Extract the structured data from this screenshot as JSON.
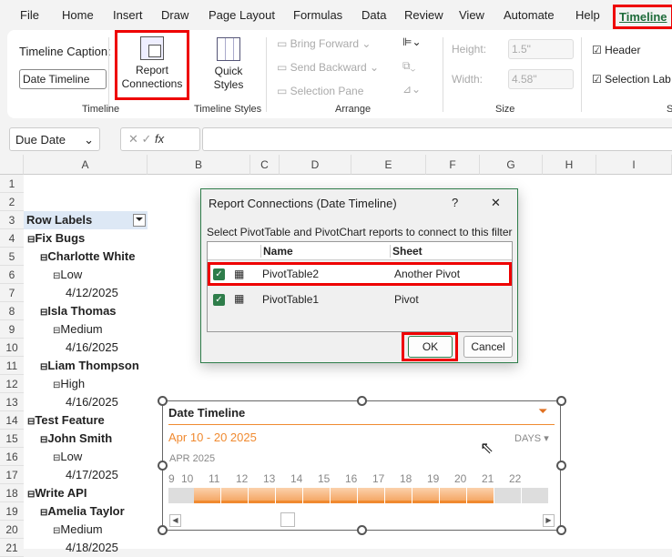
{
  "tabs": [
    "File",
    "Home",
    "Insert",
    "Draw",
    "Page Layout",
    "Formulas",
    "Data",
    "Review",
    "View",
    "Automate",
    "Help",
    "Timeline"
  ],
  "ribbon": {
    "caption_label": "Timeline Caption:",
    "caption_value": "Date Timeline",
    "report_connections": "Report Connections",
    "quick_styles": "Quick Styles",
    "bring_forward": "Bring Forward",
    "send_backward": "Send Backward",
    "selection_pane": "Selection Pane",
    "height_label": "Height:",
    "height_value": "1.5\"",
    "width_label": "Width:",
    "width_value": "4.58\"",
    "header": "Header",
    "selection_label": "Selection Lab",
    "groups": [
      "Timeline",
      "Timeline Styles",
      "Arrange",
      "Size",
      "Sh"
    ]
  },
  "formula_bar": {
    "name_box": "Due Date",
    "fx": "fx"
  },
  "columns": [
    "A",
    "B",
    "C",
    "D",
    "E",
    "F",
    "G",
    "H",
    "I"
  ],
  "rows": [
    {
      "n": "1",
      "t": "",
      "lvl": 0
    },
    {
      "n": "2",
      "t": "",
      "lvl": 0
    },
    {
      "n": "3",
      "t": "Row Labels",
      "lvl": 0,
      "hdr": true
    },
    {
      "n": "4",
      "t": "Fix Bugs",
      "lvl": 0,
      "bold": true,
      "exp": true
    },
    {
      "n": "5",
      "t": "Charlotte White",
      "lvl": 1,
      "bold": true,
      "exp": true
    },
    {
      "n": "6",
      "t": "Low",
      "lvl": 2,
      "exp": true
    },
    {
      "n": "7",
      "t": "4/12/2025",
      "lvl": 3
    },
    {
      "n": "8",
      "t": "Isla Thomas",
      "lvl": 1,
      "bold": true,
      "exp": true
    },
    {
      "n": "9",
      "t": "Medium",
      "lvl": 2,
      "exp": true
    },
    {
      "n": "10",
      "t": "4/16/2025",
      "lvl": 3
    },
    {
      "n": "11",
      "t": "Liam Thompson",
      "lvl": 1,
      "bold": true,
      "exp": true
    },
    {
      "n": "12",
      "t": "High",
      "lvl": 2,
      "exp": true
    },
    {
      "n": "13",
      "t": "4/16/2025",
      "lvl": 3
    },
    {
      "n": "14",
      "t": "Test Feature",
      "lvl": 0,
      "bold": true,
      "exp": true
    },
    {
      "n": "15",
      "t": "John Smith",
      "lvl": 1,
      "bold": true,
      "exp": true
    },
    {
      "n": "16",
      "t": "Low",
      "lvl": 2,
      "exp": true
    },
    {
      "n": "17",
      "t": "4/17/2025",
      "lvl": 3
    },
    {
      "n": "18",
      "t": "Write API",
      "lvl": 0,
      "bold": true,
      "exp": true
    },
    {
      "n": "19",
      "t": "Amelia Taylor",
      "lvl": 1,
      "bold": true,
      "exp": true
    },
    {
      "n": "20",
      "t": "Medium",
      "lvl": 2,
      "exp": true
    },
    {
      "n": "21",
      "t": "4/18/2025",
      "lvl": 3
    }
  ],
  "dialog": {
    "title": "Report Connections (Date Timeline)",
    "help": "?",
    "close": "✕",
    "instruction": "Select PivotTable and PivotChart reports to connect to this filter",
    "col_name": "Name",
    "col_sheet": "Sheet",
    "items": [
      {
        "name": "PivotTable2",
        "sheet": "Another Pivot",
        "checked": true
      },
      {
        "name": "PivotTable1",
        "sheet": "Pivot",
        "checked": true
      }
    ],
    "ok": "OK",
    "cancel": "Cancel"
  },
  "timeline": {
    "title": "Date Timeline",
    "range": "Apr 10 - 20 2025",
    "level": "DAYS",
    "month": "APR 2025",
    "days": [
      "9",
      "10",
      "11",
      "12",
      "13",
      "14",
      "15",
      "16",
      "17",
      "18",
      "19",
      "20",
      "21",
      "22"
    ],
    "selected_from": "10",
    "selected_to": "20",
    "accent": "#f08a30"
  }
}
